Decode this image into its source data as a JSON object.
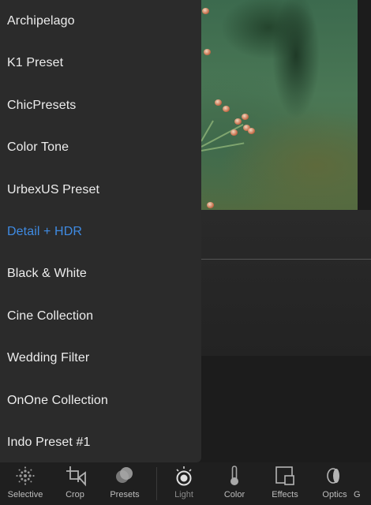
{
  "presets": [
    {
      "label": "Archipelago",
      "active": false
    },
    {
      "label": "K1 Preset",
      "active": false
    },
    {
      "label": "ChicPresets",
      "active": false
    },
    {
      "label": "Color Tone",
      "active": false
    },
    {
      "label": "UrbexUS Preset",
      "active": false
    },
    {
      "label": "Detail + HDR",
      "active": true
    },
    {
      "label": "Black & White",
      "active": false
    },
    {
      "label": "Cine Collection",
      "active": false
    },
    {
      "label": "Wedding Filter",
      "active": false
    },
    {
      "label": "OnOne Collection",
      "active": false
    },
    {
      "label": "Indo Preset #1",
      "active": false
    }
  ],
  "toolbar": {
    "tools": [
      {
        "label": "Selective",
        "icon": "selective-icon"
      },
      {
        "label": "Crop",
        "icon": "crop-icon"
      },
      {
        "label": "Presets",
        "icon": "presets-icon"
      },
      {
        "label": "Light",
        "icon": "light-icon"
      },
      {
        "label": "Color",
        "icon": "color-icon"
      },
      {
        "label": "Effects",
        "icon": "effects-icon"
      },
      {
        "label": "Optics",
        "icon": "optics-icon"
      },
      {
        "label": "G",
        "icon": "geometry-icon"
      }
    ]
  },
  "colors": {
    "drawer_bg": "#2b2b2b",
    "active_preset": "#3f8be3",
    "toolbar_bg": "#1f1f1f"
  }
}
